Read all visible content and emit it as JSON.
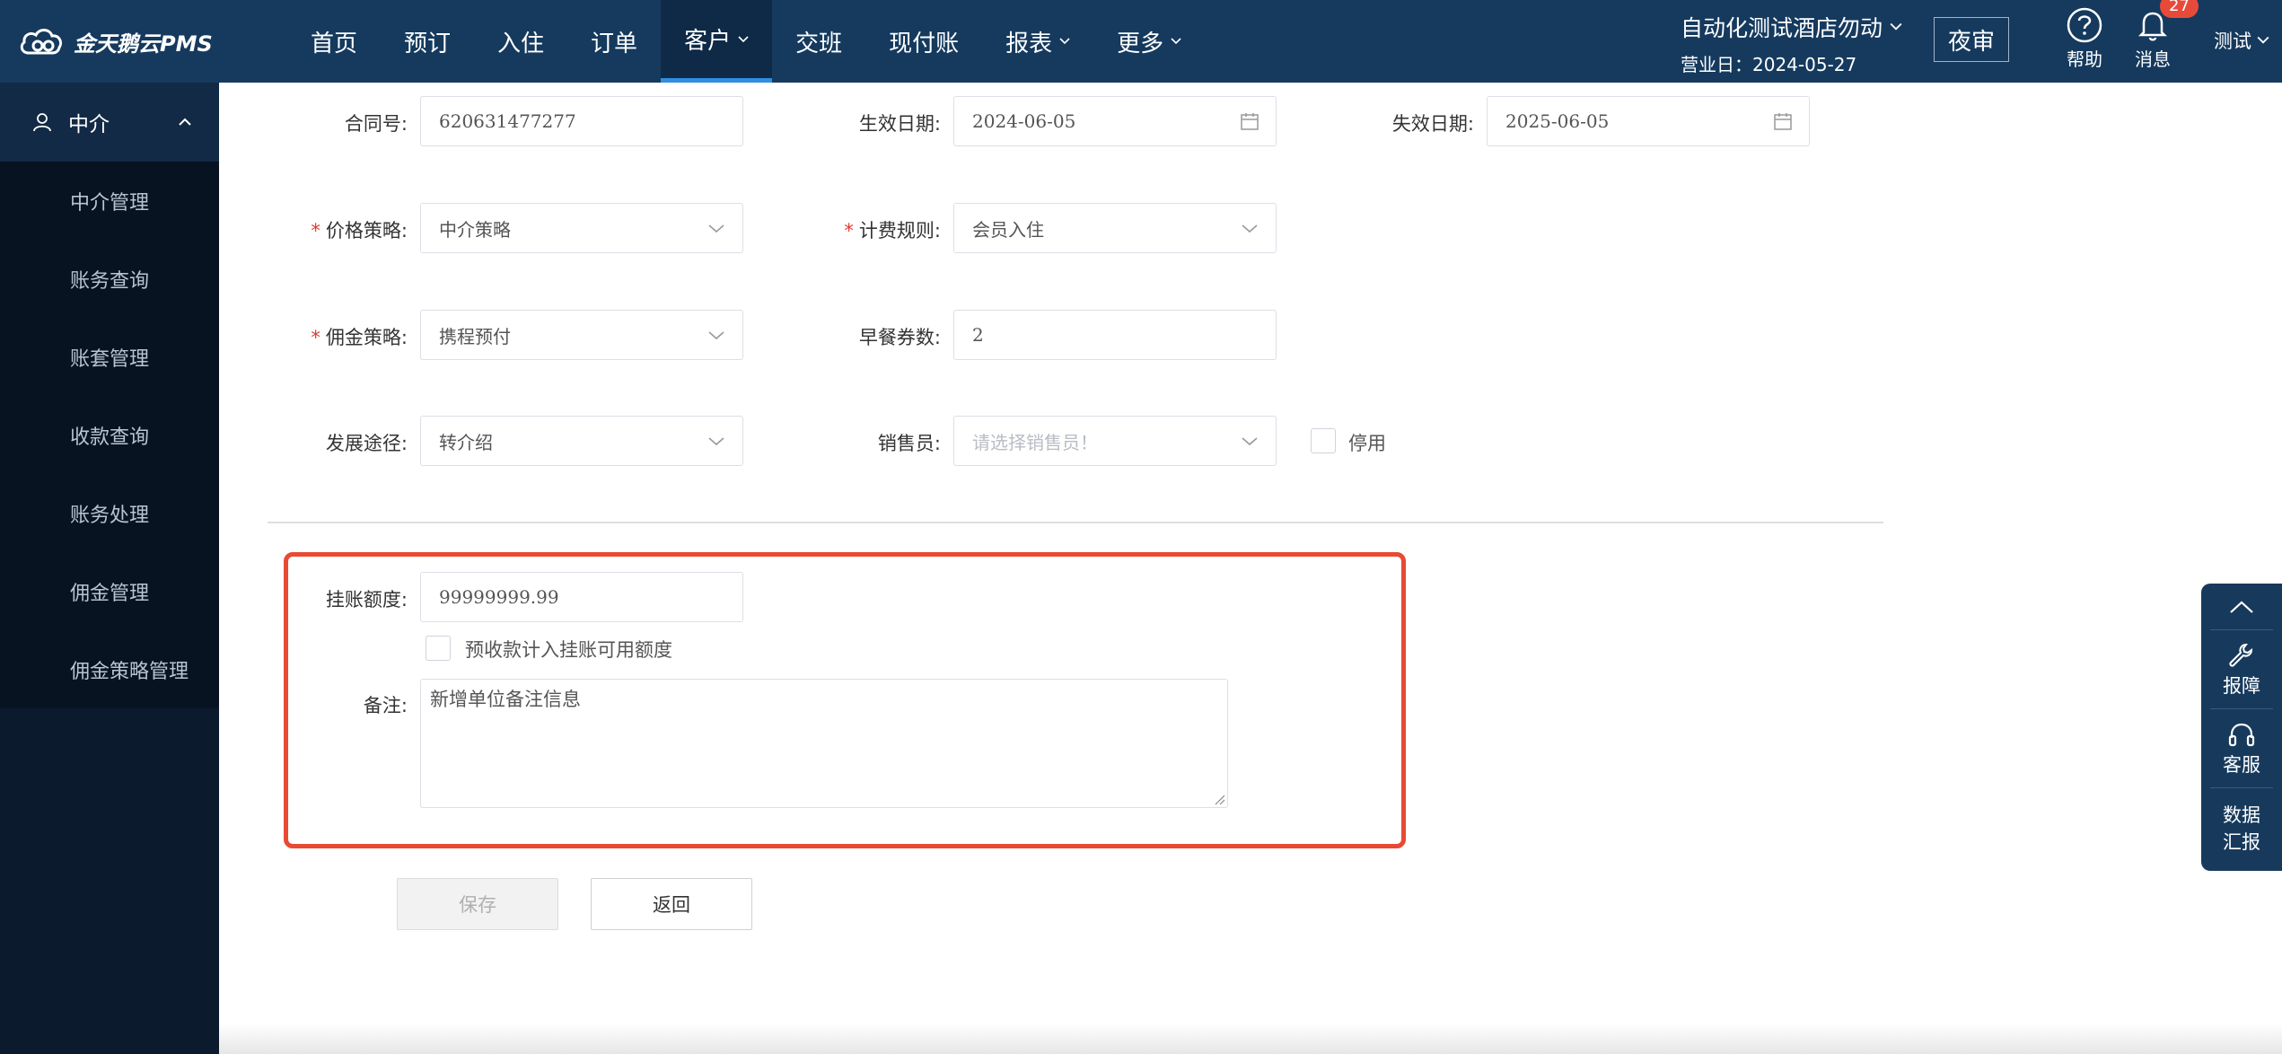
{
  "app": {
    "logo_text": "金天鹅云PMS"
  },
  "nav": {
    "items": [
      {
        "label": "首页"
      },
      {
        "label": "预订"
      },
      {
        "label": "入住"
      },
      {
        "label": "订单"
      },
      {
        "label": "客户"
      },
      {
        "label": "交班"
      },
      {
        "label": "现付账"
      },
      {
        "label": "报表"
      },
      {
        "label": "更多"
      }
    ],
    "active": "客户"
  },
  "header": {
    "hotel_name": "自动化测试酒店勿动",
    "business_date": "营业日：2024-05-27",
    "night_audit": "夜审",
    "help": "帮助",
    "messages": "消息",
    "message_count": "27",
    "user": "测试"
  },
  "sidebar": {
    "section": "中介",
    "items": [
      {
        "label": "中介管理"
      },
      {
        "label": "账务查询"
      },
      {
        "label": "账套管理"
      },
      {
        "label": "收款查询"
      },
      {
        "label": "账务处理"
      },
      {
        "label": "佣金管理"
      },
      {
        "label": "佣金策略管理"
      }
    ]
  },
  "form": {
    "contract_no_label": "合同号:",
    "contract_no": "620631477277",
    "effective_date_label": "生效日期:",
    "effective_date": "2024-06-05",
    "expire_date_label": "失效日期:",
    "expire_date": "2025-06-05",
    "price_policy_label": "价格策略:",
    "price_policy": "中介策略",
    "billing_rule_label": "计费规则:",
    "billing_rule": "会员入住",
    "commission_policy_label": "佣金策略:",
    "commission_policy": "携程预付",
    "breakfast_label": "早餐券数:",
    "breakfast": "2",
    "channel_label": "发展途径:",
    "channel": "转介绍",
    "salesperson_label": "销售员:",
    "salesperson_placeholder": "请选择销售员！",
    "disabled_label": "停用",
    "credit_limit_label": "挂账额度:",
    "credit_limit": "99999999.99",
    "prepay_label": "预收款计入挂账可用额度",
    "remark_label": "备注:",
    "remark": "新增单位备注信息",
    "save": "保存",
    "back": "返回"
  },
  "float_panel": {
    "report": "报障",
    "service": "客服",
    "data_report": "数据汇报"
  }
}
